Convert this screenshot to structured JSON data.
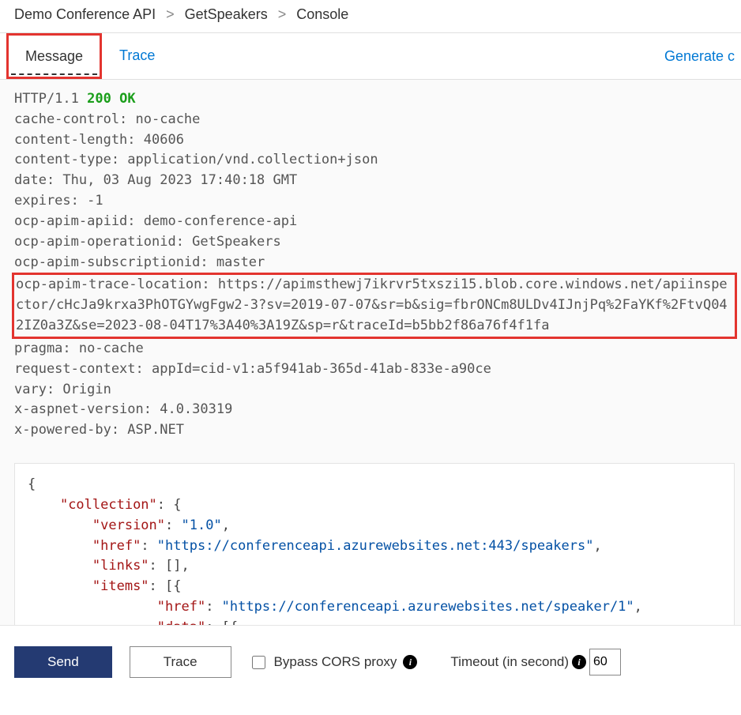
{
  "breadcrumb": {
    "items": [
      "Demo Conference API",
      "GetSpeakers",
      "Console"
    ]
  },
  "tabs": {
    "message": "Message",
    "trace": "Trace",
    "generate": "Generate c"
  },
  "response": {
    "protocol": "HTTP/1.1",
    "status": "200 OK",
    "headers_pre_trace": "cache-control: no-cache\ncontent-length: 40606\ncontent-type: application/vnd.collection+json\ndate: Thu, 03 Aug 2023 17:40:18 GMT\nexpires: -1\nocp-apim-apiid: demo-conference-api\nocp-apim-operationid: GetSpeakers\nocp-apim-subscriptionid: master",
    "trace_location": "ocp-apim-trace-location: https://apimsthewj7ikrvr5txszi15.blob.core.windows.net/apiinspector/cHcJa9krxa3PhOTGYwgFgw2-3?sv=2019-07-07&sr=b&sig=fbrONCm8ULDv4IJnjPq%2FaYKf%2FtvQ042IZ0a3Z&se=2023-08-04T17%3A40%3A19Z&sp=r&traceId=b5bb2f86a76f4f1fa",
    "headers_post_trace": "pragma: no-cache\nrequest-context: appId=cid-v1:a5f941ab-365d-41ab-833e-a90ce\nvary: Origin\nx-aspnet-version: 4.0.30319\nx-powered-by: ASP.NET"
  },
  "body": {
    "collection_key": "\"collection\"",
    "version_k": "\"version\"",
    "version_v": "\"1.0\"",
    "href_k": "\"href\"",
    "href_v": "\"https://conferenceapi.azurewebsites.net:443/speakers\"",
    "links_k": "\"links\"",
    "items_k": "\"items\"",
    "item_href_k": "\"href\"",
    "item_href_v": "\"https://conferenceapi.azurewebsites.net/speaker/1\"",
    "data_k": "\"data\""
  },
  "footer": {
    "send": "Send",
    "trace": "Trace",
    "bypass": "Bypass CORS proxy",
    "timeout_label": "Timeout (in second)",
    "timeout_value": "60"
  }
}
